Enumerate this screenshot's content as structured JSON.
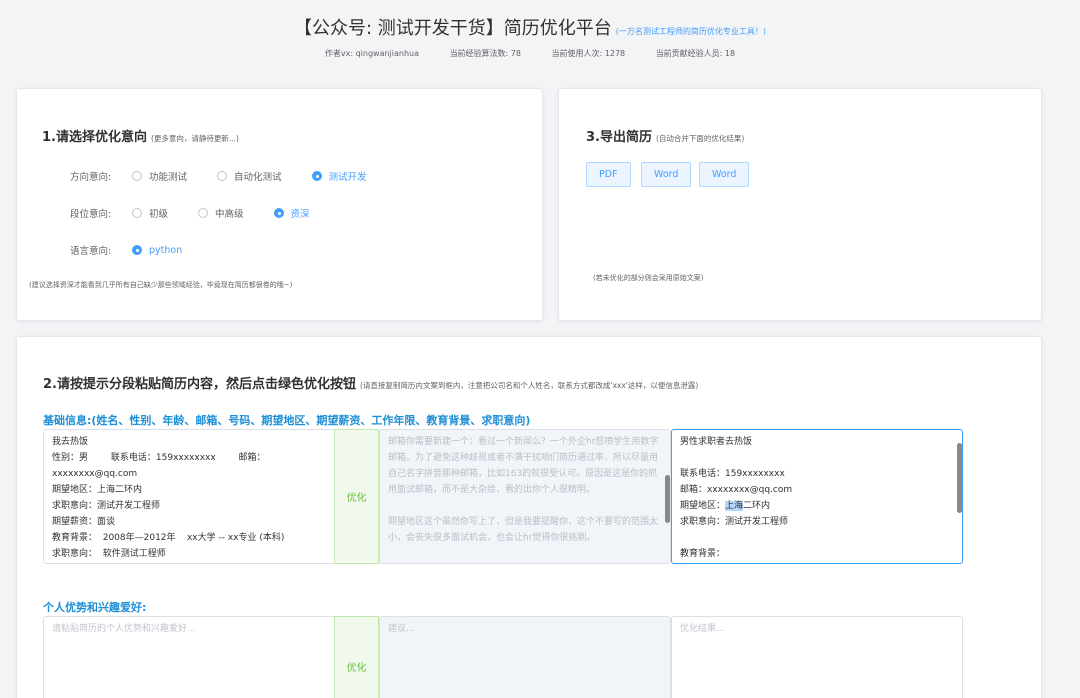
{
  "header": {
    "title": "【公众号: 测试开发干货】简历优化平台",
    "subtitle": "(一万名测试工程师的简历优化专业工具！)",
    "author": "作者vx: qingwanjianhua",
    "algorithms": "当前经验算法数: 78",
    "usage": "当前使用人次: 1278",
    "contributors": "当前贡献经验人员: 18"
  },
  "card1": {
    "title": "1.请选择优化意向",
    "subtitle": "(更多意向，请静待更新...)",
    "direction_label": "方向意向:",
    "direction_options": [
      "功能测试",
      "自动化测试",
      "测试开发"
    ],
    "direction_selected": "测试开发",
    "level_label": "段位意向:",
    "level_options": [
      "初级",
      "中高级",
      "资深"
    ],
    "level_selected": "资深",
    "language_label": "语言意向:",
    "language_options": [
      "python"
    ],
    "language_selected": "python",
    "note": "(建议选择资深才能看到几乎所有自己缺少那些领域经验，毕竟现在简历都很卷的哦~)"
  },
  "card3": {
    "title": "3.导出简历",
    "subtitle": "(自动合并下面的优化结果)",
    "buttons": [
      "PDF",
      "Word",
      "Word"
    ],
    "note": "(若未优化的部分则会采用原始文案)"
  },
  "card2": {
    "title": "2.请按提示分段粘贴简历内容，然后点击绿色优化按钮",
    "subtitle": "(请直接复制简历内文案到框内，注意把公司名和个人姓名，联系方式都改成'xxx'这样，以便信息泄露)",
    "basic": {
      "label": "基础信息:(姓名、性别、年龄、邮箱、号码、期望地区、期望薪资、工作年限、教育背景、求职意向)",
      "input": "我去热饭\n性别：男        联系电话：159xxxxxxxx        邮箱：xxxxxxxx@qq.com\n期望地区：上海二环内\n求职意向：测试开发工程师\n期望薪资：面谈\n教育背景：  2008年—2012年    xx大学 -- xx专业 (本科)\n求职意向：  软件测试工程师",
      "optimize": "优化",
      "advice": "邮箱你需要新建一个：看过一个新闻么？一个外企hr怒喷学生用数字邮箱。为了避免这种歧视或者不满干扰咱们简历通过率，所以尽量用自己名字拼音那种邮箱，比如163的就很受认可。原因是这是你的抓用面试邮箱，而不是大杂烩，看的出你个人很精明。\n\n期望地区这个虽然你写上了，但是我要提醒你，这个不要写的范围太小，会丧失很多面试机会，也会让hr觉得你很挑剔。",
      "result_line1": "男性求职者去热饭",
      "result_line2": "",
      "result_line3": "联系电话：159xxxxxxxx",
      "result_line4": "邮箱：xxxxxxxx@qq.com",
      "result_prefix5": "期望地区：",
      "result_highlight5": "上海",
      "result_suffix5": "二环内",
      "result_line6": "求职意向：测试开发工程师",
      "result_line7": "",
      "result_line8": "教育背景："
    },
    "hobby": {
      "label": "个人优势和兴趣爱好:",
      "input_placeholder": "请粘贴简历的个人优势和兴趣爱好...",
      "optimize": "优化",
      "advice_placeholder": "建议...",
      "result_placeholder": "优化结果..."
    }
  }
}
